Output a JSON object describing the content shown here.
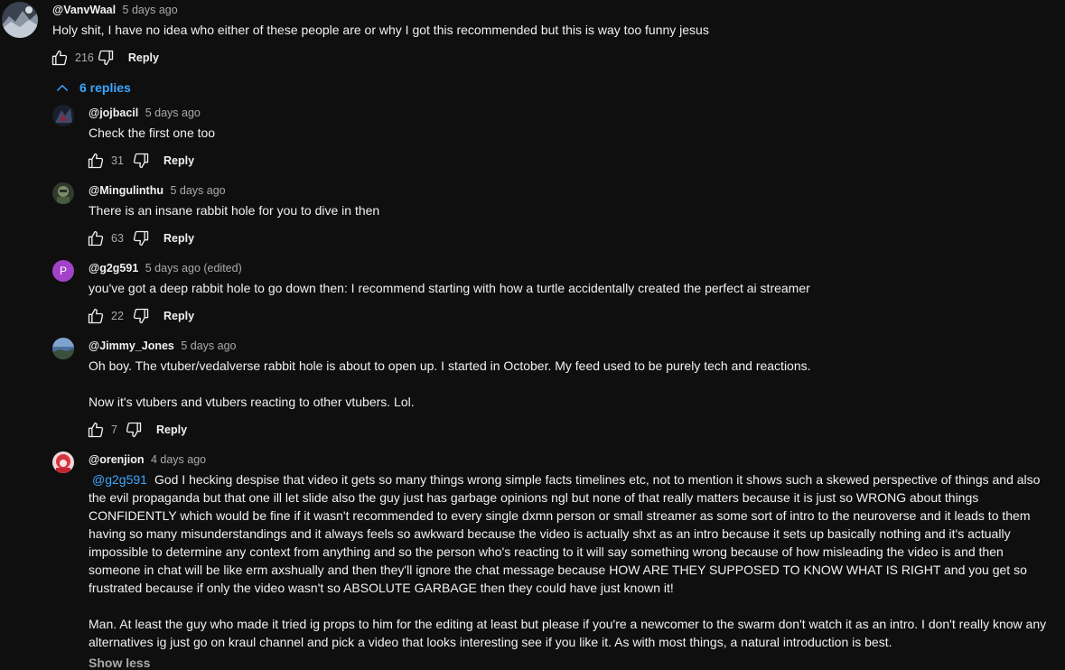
{
  "top_comment": {
    "author": "@VanvWaal",
    "time": "5 days ago",
    "text": "Holy shit, I have no idea who either of these people are or why I got this recommended but this is way too funny jesus",
    "likes": "216",
    "reply_label": "Reply"
  },
  "replies_toggle": {
    "label": "6 replies"
  },
  "replies": [
    {
      "author": "@jojbacil",
      "time": "5 days ago",
      "text": "Check the first one too",
      "likes": "31",
      "reply_label": "Reply"
    },
    {
      "author": "@Mingulinthu",
      "time": "5 days ago",
      "text": "There is an insane rabbit hole for you to dive in then",
      "likes": "63",
      "reply_label": "Reply"
    },
    {
      "author": "@g2g591",
      "time": "5 days ago (edited)",
      "avatar_letter": "P",
      "avatar_color": "#a142c9",
      "text": "you've got a deep rabbit hole to go down then: I recommend starting with how a turtle accidentally created the perfect ai streamer",
      "likes": "22",
      "reply_label": "Reply"
    },
    {
      "author": "@Jimmy_Jones",
      "time": "5 days ago",
      "text_p1": "Oh boy. The vtuber/vedalverse rabbit hole is about to open up. I started in October. My feed used to be purely tech and reactions.",
      "text_p2": "Now it's vtubers and vtubers reacting to other vtubers. Lol.",
      "likes": "7",
      "reply_label": "Reply"
    },
    {
      "author": "@orenjion",
      "time": "4 days ago",
      "mention": "@g2g591",
      "text_p1": "God I hecking despise that video it gets so many things wrong simple facts timelines etc, not to mention it shows such a skewed perspective of things and also the evil propaganda but that one ill let slide also the guy just has garbage opinions ngl but none of that really matters because it is just so WRONG about things CONFIDENTLY which would be fine if it wasn't recommended to every single dxmn person or small streamer as some sort of intro to the neuroverse and it leads to them having so many misunderstandings and it always feels so awkward because the video is actually shxt as an intro because it sets up basically nothing and it's actually impossible to determine any context from anything and so the person who's reacting to it will say something wrong because of how misleading the video is and then someone in chat will be like erm axshually and then they'll ignore the chat message because HOW ARE THEY SUPPOSED TO KNOW WHAT IS RIGHT and you get so frustrated because if only the video wasn't so ABSOLUTE GARBAGE then they could have just known it!",
      "text_p2": "Man. At least the guy who made it tried ig props to him for the editing at least but please if you're a newcomer to the swarm don't watch it as an intro. I don't really know any alternatives ig just go on kraul channel and pick a video that looks interesting see if you like it. As with most things, a natural introduction is best.",
      "show_less": "Show less"
    }
  ],
  "colors": {
    "background": "#0f0f0f",
    "text": "#f1f1f1",
    "secondary": "#aaaaaa",
    "link": "#3ea6ff"
  },
  "icons": {
    "like": "thumbs-up-icon",
    "dislike": "thumbs-down-icon",
    "toggle": "chevron-up-icon"
  }
}
